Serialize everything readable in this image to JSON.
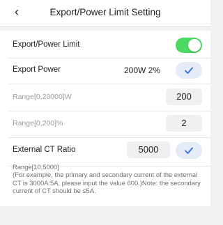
{
  "header": {
    "title": "Export/Power Limit Setting",
    "back_icon": "chevron-left-icon"
  },
  "rows": {
    "export_limit": {
      "label": "Export/Power Limit",
      "toggle_on": true,
      "toggle_color": "#4cd964"
    },
    "export_power": {
      "label": "Export Power",
      "value": "200W 2%"
    },
    "range_w": {
      "label": "Range[0,20000]W",
      "value": "200"
    },
    "range_pct": {
      "label": "Range[0,200]%",
      "value": "2"
    },
    "ct_ratio": {
      "label": "External CT Ratio",
      "value": "5000"
    }
  },
  "note": {
    "range": "Range[10,5000]",
    "text": "(For example, the primary and secondary current of the external CT is 3000A:5A, please input the value 600.)Note: the secondary current of CT should be ≤5A."
  },
  "colors": {
    "accent": "#2a6fdb",
    "check_bg": "#e6ecf7"
  }
}
